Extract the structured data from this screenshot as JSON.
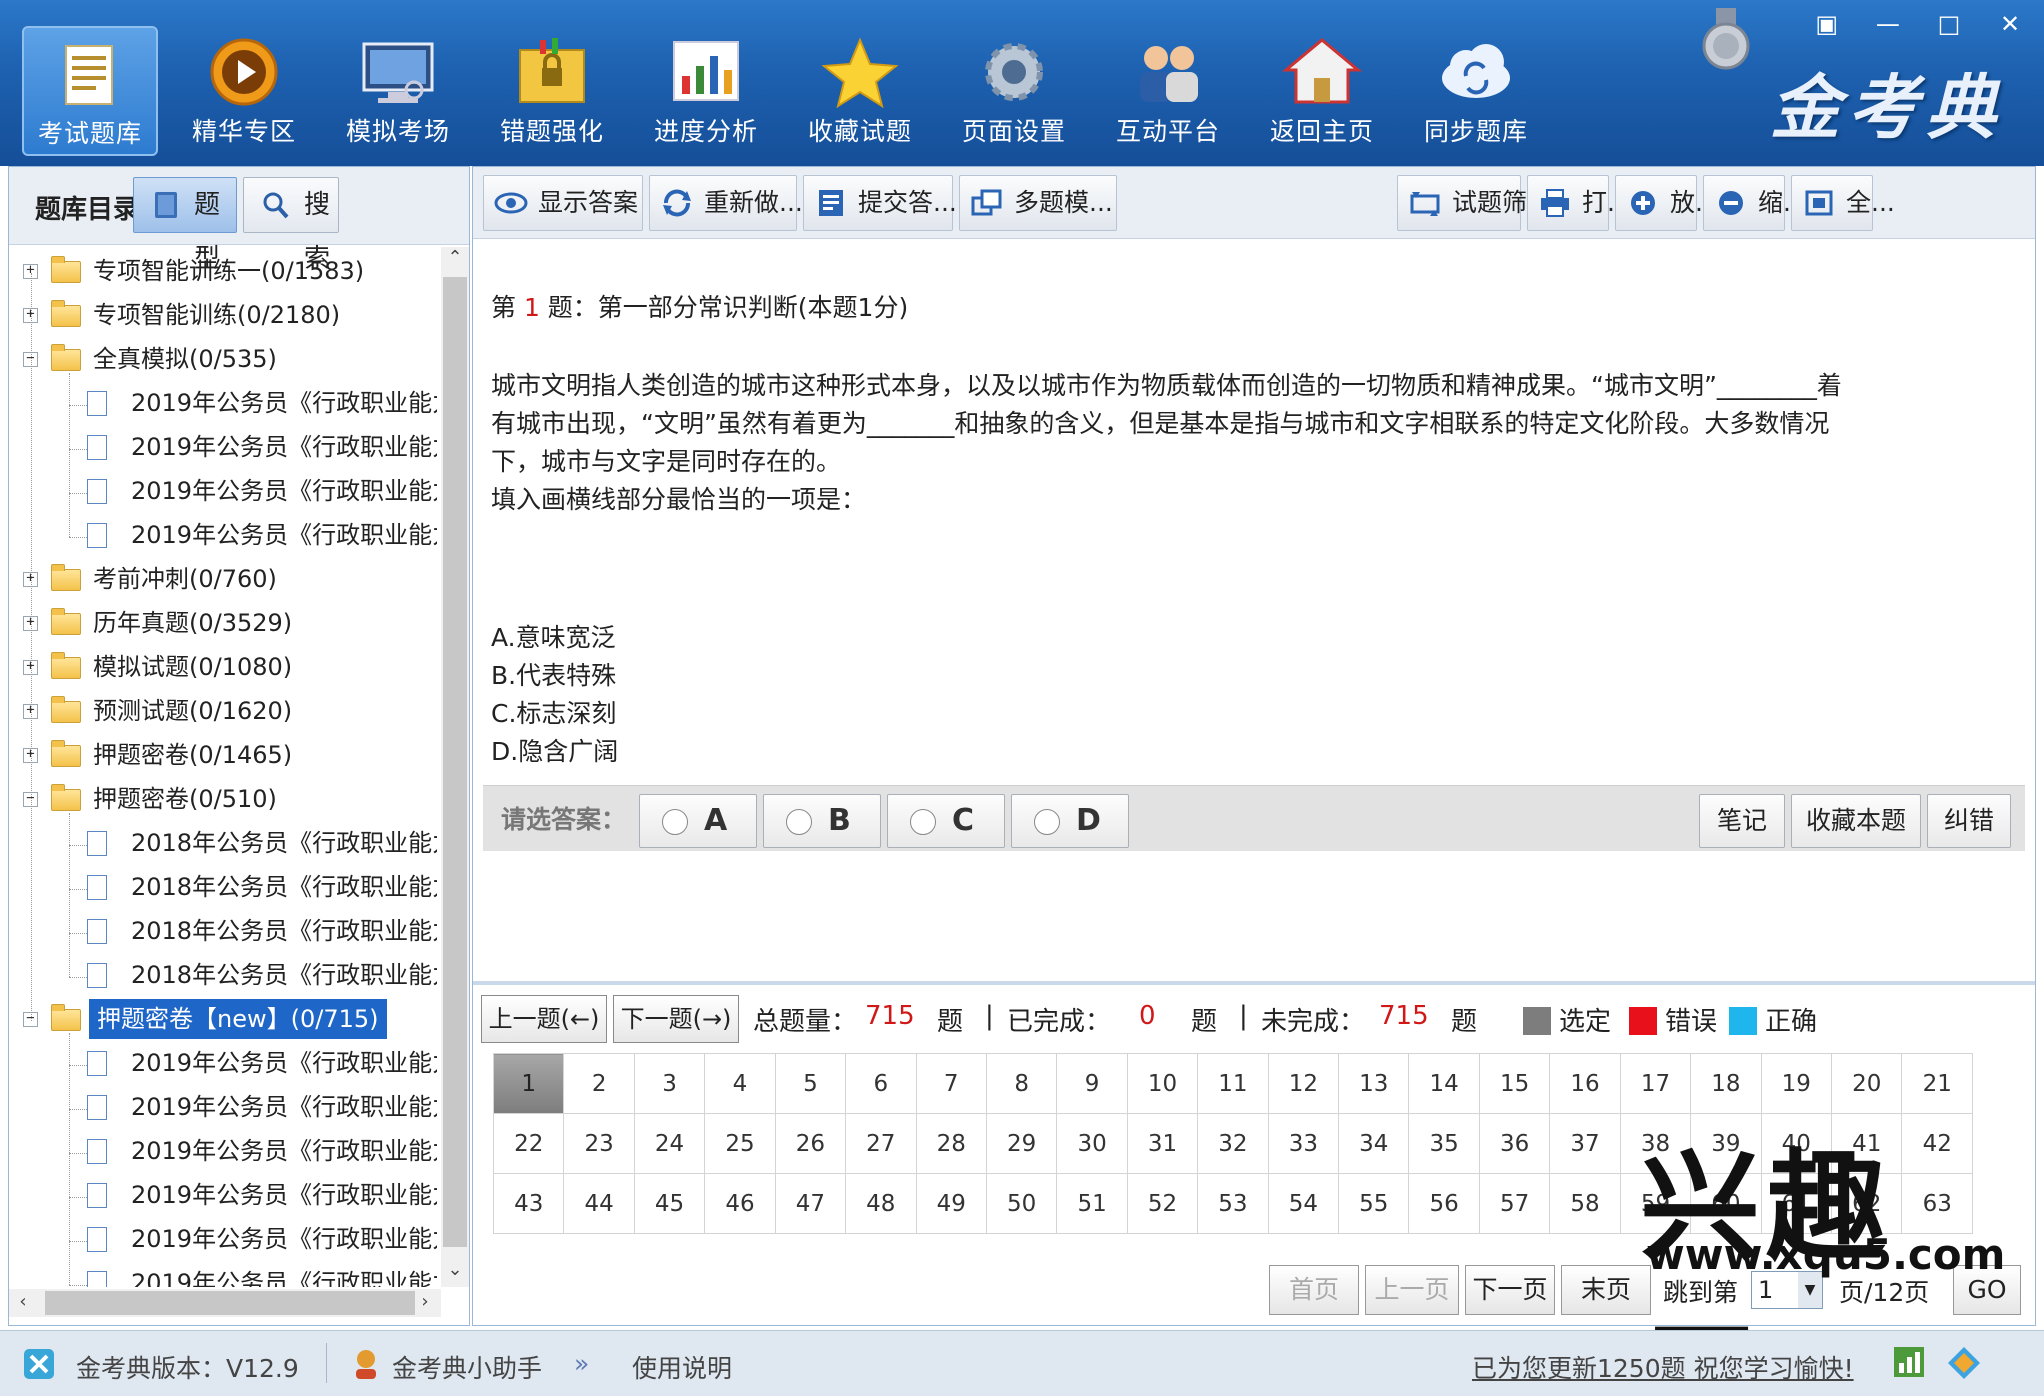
{
  "nav": {
    "items": [
      {
        "label": "考试题库",
        "icon": "notebook-icon",
        "active": true
      },
      {
        "label": "精华专区",
        "icon": "play-icon",
        "active": false
      },
      {
        "label": "模拟考场",
        "icon": "monitor-icon",
        "active": false
      },
      {
        "label": "错题强化",
        "icon": "lock-folder-icon",
        "active": false
      },
      {
        "label": "进度分析",
        "icon": "chart-icon",
        "active": false
      },
      {
        "label": "收藏试题",
        "icon": "star-icon",
        "active": false
      },
      {
        "label": "页面设置",
        "icon": "gear-icon",
        "active": false
      },
      {
        "label": "互动平台",
        "icon": "users-icon",
        "active": false
      },
      {
        "label": "返回主页",
        "icon": "home-icon",
        "active": false
      },
      {
        "label": "同步题库",
        "icon": "cloud-sync-icon",
        "active": false
      }
    ],
    "brand": "金考典",
    "window_controls": [
      "▣",
      "—",
      "□",
      "✕"
    ]
  },
  "left": {
    "title": "题库目录",
    "tab_type": "题型",
    "tab_search": "搜索",
    "tree": [
      {
        "level": 0,
        "kind": "folder",
        "expanded": false,
        "label": "专项智能训练一(0/1583)"
      },
      {
        "level": 0,
        "kind": "folder",
        "expanded": false,
        "label": "专项智能训练(0/2180)"
      },
      {
        "level": 0,
        "kind": "folder",
        "expanded": true,
        "label": "全真模拟(0/535)"
      },
      {
        "level": 1,
        "kind": "doc",
        "label": "2019年公务员《行政职业能力"
      },
      {
        "level": 1,
        "kind": "doc",
        "label": "2019年公务员《行政职业能力"
      },
      {
        "level": 1,
        "kind": "doc",
        "label": "2019年公务员《行政职业能力"
      },
      {
        "level": 1,
        "kind": "doc",
        "label": "2019年公务员《行政职业能力"
      },
      {
        "level": 0,
        "kind": "folder",
        "expanded": false,
        "label": "考前冲刺(0/760)"
      },
      {
        "level": 0,
        "kind": "folder",
        "expanded": false,
        "label": "历年真题(0/3529)"
      },
      {
        "level": 0,
        "kind": "folder",
        "expanded": false,
        "label": "模拟试题(0/1080)"
      },
      {
        "level": 0,
        "kind": "folder",
        "expanded": false,
        "label": "预测试题(0/1620)"
      },
      {
        "level": 0,
        "kind": "folder",
        "expanded": false,
        "label": "押题密卷(0/1465)"
      },
      {
        "level": 0,
        "kind": "folder",
        "expanded": true,
        "label": "押题密卷(0/510)"
      },
      {
        "level": 1,
        "kind": "doc",
        "label": "2018年公务员《行政职业能力"
      },
      {
        "level": 1,
        "kind": "doc",
        "label": "2018年公务员《行政职业能力"
      },
      {
        "level": 1,
        "kind": "doc",
        "label": "2018年公务员《行政职业能力"
      },
      {
        "level": 1,
        "kind": "doc",
        "label": "2018年公务员《行政职业能力"
      },
      {
        "level": 0,
        "kind": "folder",
        "expanded": true,
        "selected": true,
        "label": "押题密卷【new】(0/715)"
      },
      {
        "level": 1,
        "kind": "doc",
        "label": "2019年公务员《行政职业能力"
      },
      {
        "level": 1,
        "kind": "doc",
        "label": "2019年公务员《行政职业能力"
      },
      {
        "level": 1,
        "kind": "doc",
        "label": "2019年公务员《行政职业能力"
      },
      {
        "level": 1,
        "kind": "doc",
        "label": "2019年公务员《行政职业能力"
      },
      {
        "level": 1,
        "kind": "doc",
        "label": "2019年公务员《行政职业能力"
      },
      {
        "level": 1,
        "kind": "doc",
        "label": "2019年公务员《行政职业能力"
      }
    ]
  },
  "toolbar": {
    "left": [
      "显示答案",
      "重新做...",
      "提交答...",
      "多题模..."
    ],
    "right": [
      "试题筛...",
      "打...",
      "放...",
      "缩...",
      "全..."
    ]
  },
  "question": {
    "prefix": "第 ",
    "number": "1",
    "suffix": " 题：第一部分常识判断(本题1分)",
    "body_line1": "城市文明指人类创造的城市这种形式本身，以及以城市作为物质载体而创造的一切物质和精神成果。“城市文明”________着",
    "body_line2": "有城市出现，“文明”虽然有着更为_______和抽象的含义，但是基本是指与城市和文字相联系的特定文化阶段。大多数情况",
    "body_line3": "下，城市与文字是同时存在的。",
    "body_line4": "填入画横线部分最恰当的一项是：",
    "options": [
      "A.意味宽泛",
      "B.代表特殊",
      "C.标志深刻",
      "D.隐含广阔"
    ]
  },
  "answer": {
    "label": "请选答案：",
    "choices": [
      "A",
      "B",
      "C",
      "D"
    ],
    "note": "笔记",
    "favorite": "收藏本题",
    "report": "纠错"
  },
  "nav_row": {
    "prev": "上一题(←)",
    "next": "下一题(→)",
    "total_label": "总题量：",
    "total": "715",
    "unit": "题",
    "done_label": "已完成：",
    "done": "0",
    "todo_label": "未完成：",
    "todo": "715",
    "divider": "|",
    "legend_selected": "选定",
    "legend_wrong": "错误",
    "legend_right": "正确",
    "color_selected": "#7d7d7d",
    "color_wrong": "#e8101a",
    "color_right": "#1fb6ee"
  },
  "grid": {
    "rows": [
      [
        "1",
        "2",
        "3",
        "4",
        "5",
        "6",
        "7",
        "8",
        "9",
        "10",
        "11",
        "12",
        "13",
        "14",
        "15",
        "16",
        "17",
        "18",
        "19",
        "20",
        "21"
      ],
      [
        "22",
        "23",
        "24",
        "25",
        "26",
        "27",
        "28",
        "29",
        "30",
        "31",
        "32",
        "33",
        "34",
        "35",
        "36",
        "37",
        "38",
        "39",
        "40",
        "41",
        "42"
      ],
      [
        "43",
        "44",
        "45",
        "46",
        "47",
        "48",
        "49",
        "50",
        "51",
        "52",
        "53",
        "54",
        "55",
        "56",
        "57",
        "58",
        "59",
        "60",
        "61",
        "62",
        "63"
      ]
    ],
    "current": "1"
  },
  "pager": {
    "first": "首页",
    "prev": "上一页",
    "next": "下一页",
    "last": "末页",
    "jump_label": "跳到第",
    "page_value": "1",
    "total_pages": "页/12页",
    "go": "GO"
  },
  "watermark": {
    "text": "兴趣屋",
    "url": "www.xqu5.com"
  },
  "status": {
    "version": "金考典版本：V12.9",
    "assistant": "金考典小助手",
    "guide": "使用说明",
    "update": "已为您更新1250题 祝您学习愉快!"
  }
}
